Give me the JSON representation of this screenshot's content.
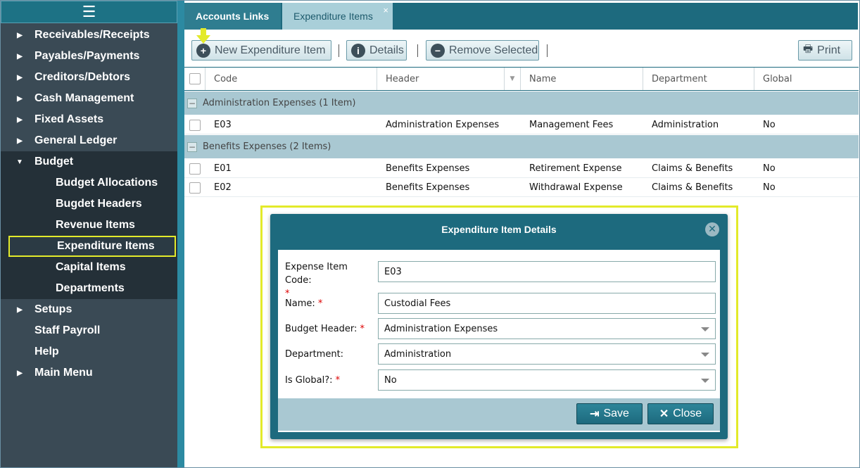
{
  "sidebar": {
    "menu_icon": "hamburger-icon",
    "items": [
      {
        "label": "Receivables/Receipts"
      },
      {
        "label": "Payables/Payments"
      },
      {
        "label": "Creditors/Debtors"
      },
      {
        "label": "Cash Management"
      },
      {
        "label": "Fixed Assets"
      },
      {
        "label": "General Ledger"
      },
      {
        "label": "Budget"
      }
    ],
    "budget_sub": [
      {
        "label": "Budget Allocations"
      },
      {
        "label": "Bugdet Headers"
      },
      {
        "label": "Revenue Items"
      },
      {
        "label": "Expenditure Items"
      },
      {
        "label": "Capital Items"
      },
      {
        "label": "Departments"
      }
    ],
    "bottom": [
      {
        "label": "Setups"
      },
      {
        "label": "Staff Payroll"
      },
      {
        "label": "Help"
      },
      {
        "label": "Main Menu"
      }
    ]
  },
  "tabs": {
    "accounts_links": "Accounts Links",
    "expenditure_items": "Expenditure Items",
    "close": "×"
  },
  "toolbar": {
    "new": "New Expenditure Item",
    "details": "Details",
    "remove": "Remove Selected",
    "print": "Print"
  },
  "grid": {
    "columns": [
      "Code",
      "Header",
      "Name",
      "Department",
      "Global"
    ],
    "groups": [
      {
        "title": "Administration Expenses (1 Item)",
        "rows": [
          {
            "code": "E03",
            "header": "Administration Expenses",
            "name": "Management Fees",
            "department": "Administration",
            "global": "No"
          }
        ]
      },
      {
        "title": "Benefits Expenses (2 Items)",
        "rows": [
          {
            "code": "E01",
            "header": "Benefits Expenses",
            "name": "Retirement Expense",
            "department": "Claims & Benefits",
            "global": "No"
          },
          {
            "code": "E02",
            "header": "Benefits Expenses",
            "name": "Withdrawal Expense",
            "department": "Claims & Benefits",
            "global": "No"
          }
        ]
      }
    ]
  },
  "modal": {
    "title": "Expenditure Item Details",
    "fields": {
      "code_label": "Expense Item Code:",
      "code_value": "E03",
      "name_label": "Name:",
      "name_value": "Custodial Fees",
      "header_label": "Budget Header:",
      "header_value": "Administration Expenses",
      "dept_label": "Department:",
      "dept_value": "Administration",
      "global_label": "Is Global?:",
      "global_value": "No"
    },
    "required_mark": "*",
    "save": "Save",
    "close": "Close"
  },
  "colors": {
    "sidebar_bg": "#3a4a55",
    "accent": "#1d6a7e",
    "highlight": "#e3ea2a"
  }
}
